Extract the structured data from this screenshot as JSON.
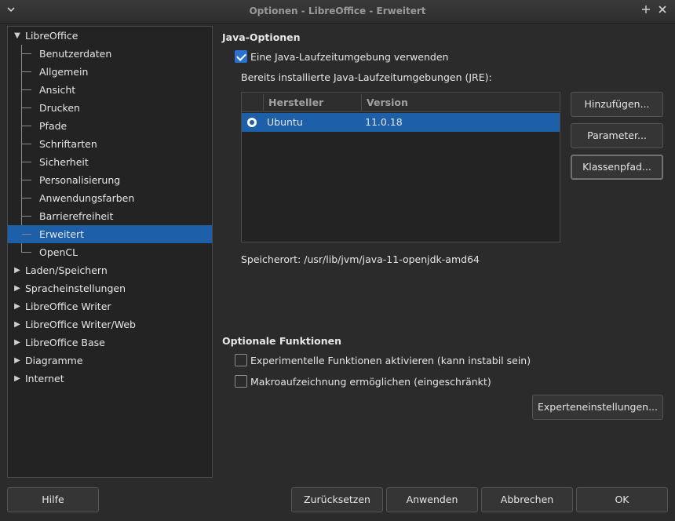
{
  "window": {
    "title": "Optionen - LibreOffice - Erweitert"
  },
  "icons": {
    "menu": "chevron-down-icon",
    "pin": "pin-icon",
    "close": "close-icon"
  },
  "tree": {
    "root": "LibreOffice",
    "children": [
      "Benutzerdaten",
      "Allgemein",
      "Ansicht",
      "Drucken",
      "Pfade",
      "Schriftarten",
      "Sicherheit",
      "Personalisierung",
      "Anwendungsfarben",
      "Barrierefreiheit",
      "Erweitert",
      "OpenCL"
    ],
    "selected": "Erweitert",
    "collapsed": [
      "Laden/Speichern",
      "Spracheinstellungen",
      "LibreOffice Writer",
      "LibreOffice Writer/Web",
      "LibreOffice Base",
      "Diagramme",
      "Internet"
    ]
  },
  "java": {
    "section_title": "Java-Optionen",
    "use_jre_label": "Eine Java-Laufzeitumgebung verwenden",
    "use_jre_checked": true,
    "installed_label": "Bereits installierte Java-Laufzeitumgebungen (JRE):",
    "columns": [
      "Hersteller",
      "Version"
    ],
    "rows": [
      {
        "vendor": "Ubuntu",
        "version": "11.0.18",
        "selected": true
      }
    ],
    "location": "Speicherort: /usr/lib/jvm/java-11-openjdk-amd64",
    "buttons": {
      "add": "Hinzufügen...",
      "parameters": "Parameter...",
      "classpath": "Klassenpfad..."
    }
  },
  "optional": {
    "section_title": "Optionale Funktionen",
    "experimental_label": "Experimentelle Funktionen aktivieren (kann instabil sein)",
    "experimental_checked": false,
    "macro_label": "Makroaufzeichnung ermöglichen (eingeschränkt)",
    "macro_checked": false,
    "expert_button": "Experteneinstellungen..."
  },
  "footer": {
    "help": "Hilfe",
    "reset": "Zurücksetzen",
    "apply": "Anwenden",
    "cancel": "Abbrechen",
    "ok": "OK"
  },
  "colors": {
    "selection": "#1d5fa8",
    "checkbox_accent": "#2b73d1",
    "background": "#2b2b2b"
  }
}
